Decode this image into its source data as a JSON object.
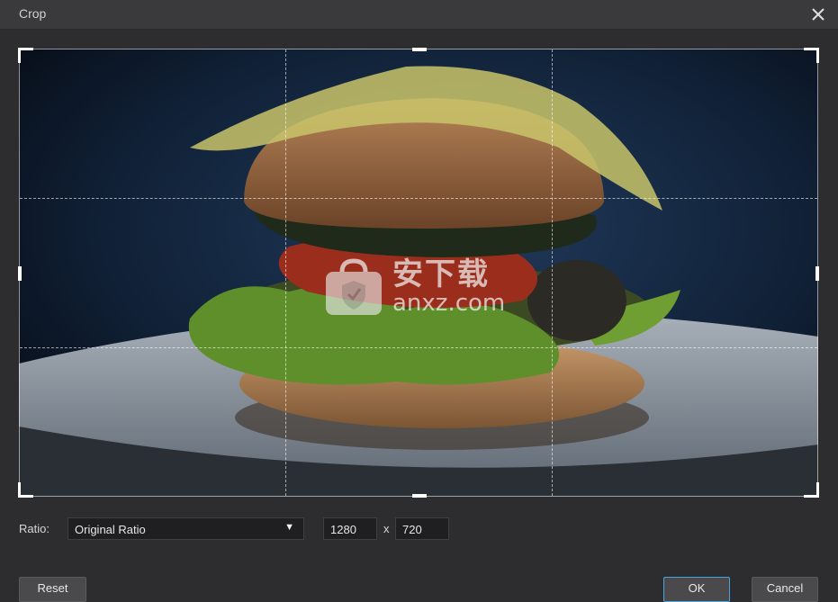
{
  "window": {
    "title": "Crop"
  },
  "icons": {
    "close": "close-icon",
    "dropdown": "caret-down-icon",
    "watermark": "shopping-bag-shield-icon"
  },
  "watermark": {
    "text_cn": "安下载",
    "text_en": "anxz.com"
  },
  "controls": {
    "ratio_label": "Ratio:",
    "ratio_value": "Original Ratio",
    "width": "1280",
    "separator": "x",
    "height": "720"
  },
  "buttons": {
    "reset": "Reset",
    "ok": "OK",
    "cancel": "Cancel"
  },
  "colors": {
    "ok_border": "#4aa3df",
    "background": "#2d2d2f",
    "titlebar": "#3a3a3c"
  }
}
